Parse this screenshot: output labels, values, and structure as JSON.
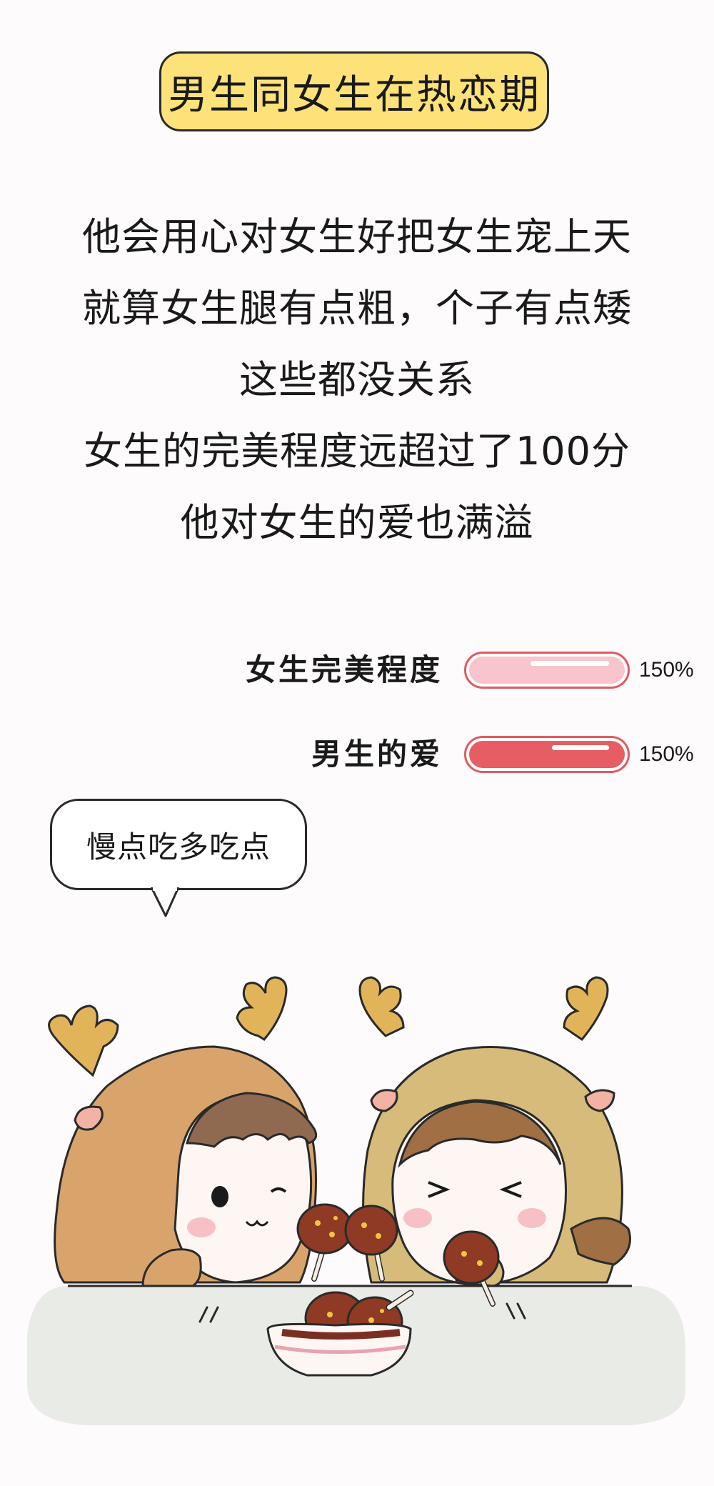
{
  "title": "男生同女生在热恋期",
  "paragraph": [
    "他会用心对女生好把女生宠上天",
    "就算女生腿有点粗，个子有点矮",
    "这些都没关系",
    "女生的完美程度远超过了100分",
    "他对女生的爱也满溢"
  ],
  "meters": [
    {
      "label": "女生完美程度",
      "value_text": "150%",
      "level_percent": 150,
      "fill_color": "#f7c5cb"
    },
    {
      "label": "男生的爱",
      "value_text": "150%",
      "level_percent": 150,
      "fill_color": "#e65d63"
    }
  ],
  "speech_bubble": "慢点吃多吃点",
  "illustration": {
    "characters": [
      "boy-deer-costume",
      "girl-deer-costume"
    ],
    "props": [
      "chicken-drumstick",
      "bowl-of-drumsticks",
      "table"
    ]
  },
  "colors": {
    "title_bg": "#fde27a",
    "meter_border": "#e05a60",
    "boy_costume": "#d9a46b",
    "girl_costume": "#d6bb7a",
    "antler": "#e2b45a",
    "table": "#e9ece6"
  }
}
